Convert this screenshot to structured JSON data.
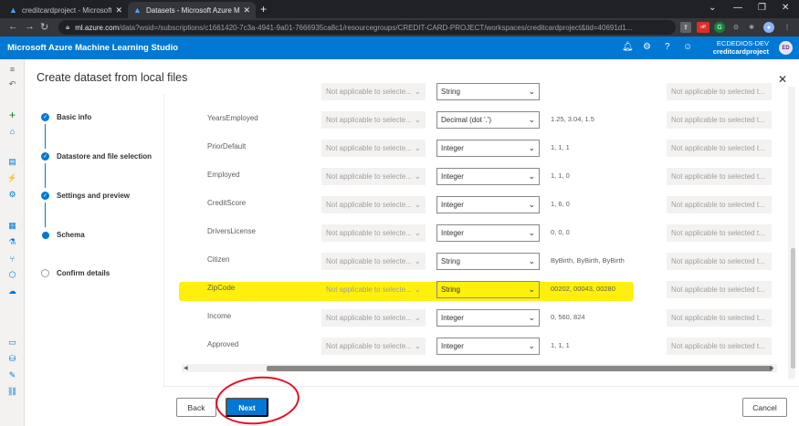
{
  "browser": {
    "tabs": [
      {
        "title": "creditcardproject - Microsoft Azu",
        "active": false
      },
      {
        "title": "Datasets - Microsoft Azure Machi",
        "active": true
      }
    ],
    "url_host": "ml.azure.com",
    "url_path": "/data?wsid=/subscriptions/c1661420-7c3a-4941-9a01-7666935ca8c1/resourcegroups/CREDIT-CARD-PROJECT/workspaces/creditcardproject&tid=40691d1...",
    "ext_badge": "off",
    "ext_letter": "G"
  },
  "app": {
    "title": "Microsoft Azure Machine Learning Studio",
    "account_name": "ECDEDIOS-DEV",
    "workspace": "creditcardproject",
    "avatar_initials": "ED"
  },
  "dialog": {
    "title": "Create dataset from local files",
    "steps": [
      {
        "label": "Basic info",
        "state": "done"
      },
      {
        "label": "Datastore and file selection",
        "state": "done"
      },
      {
        "label": "Settings and preview",
        "state": "done"
      },
      {
        "label": "Schema",
        "state": "current"
      },
      {
        "label": "Confirm details",
        "state": "todo"
      }
    ],
    "schema_rows": [
      {
        "name": "",
        "format": "Not applicable to selecte...",
        "type": "String",
        "sample": "",
        "extra": "Not applicable to selected t..."
      },
      {
        "name": "YearsEmployed",
        "format": "Not applicable to selecte...",
        "type": "Decimal (dot '.')",
        "sample": "1.25, 3.04, 1.5",
        "extra": "Not applicable to selected t..."
      },
      {
        "name": "PriorDefault",
        "format": "Not applicable to selecte...",
        "type": "Integer",
        "sample": "1, 1, 1",
        "extra": "Not applicable to selected t..."
      },
      {
        "name": "Employed",
        "format": "Not applicable to selecte...",
        "type": "Integer",
        "sample": "1, 1, 0",
        "extra": "Not applicable to selected t..."
      },
      {
        "name": "CreditScore",
        "format": "Not applicable to selecte...",
        "type": "Integer",
        "sample": "1, 6, 0",
        "extra": "Not applicable to selected t..."
      },
      {
        "name": "DriversLicense",
        "format": "Not applicable to selecte...",
        "type": "Integer",
        "sample": "0, 0, 0",
        "extra": "Not applicable to selected t..."
      },
      {
        "name": "Citizen",
        "format": "Not applicable to selecte...",
        "type": "String",
        "sample": "ByBirth, ByBirth, ByBirth",
        "extra": "Not applicable to selected t..."
      },
      {
        "name": "ZipCode",
        "format": "Not applicable to selecte...",
        "type": "String",
        "sample": "00202, 00043, 00280",
        "extra": "Not applicable to selected t..."
      },
      {
        "name": "Income",
        "format": "Not applicable to selecte...",
        "type": "Integer",
        "sample": "0, 560, 824",
        "extra": "Not applicable to selected t..."
      },
      {
        "name": "Approved",
        "format": "Not applicable to selecte...",
        "type": "Integer",
        "sample": "1, 1, 1",
        "extra": "Not applicable to selected t..."
      }
    ],
    "buttons": {
      "back": "Back",
      "next": "Next",
      "cancel": "Cancel"
    }
  },
  "colors": {
    "accent": "#0078d4",
    "highlight": "#ffee00",
    "annotation": "#e81123"
  }
}
